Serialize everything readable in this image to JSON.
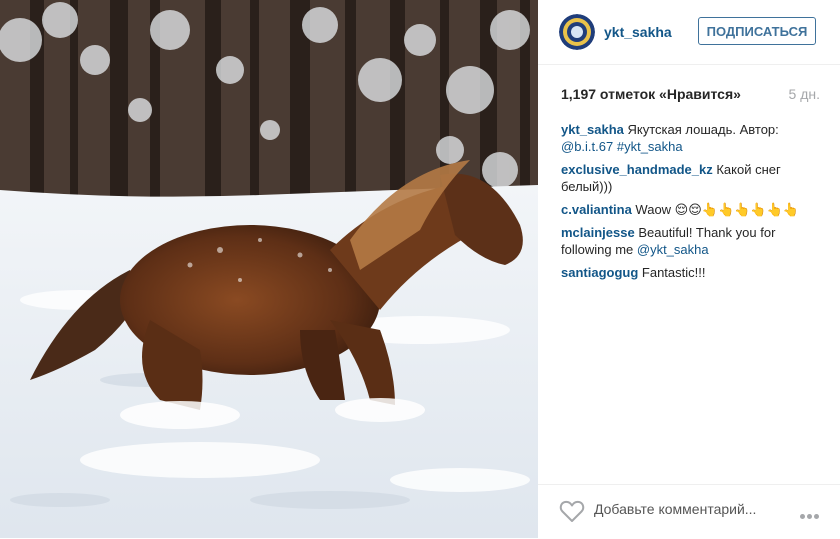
{
  "post": {
    "photo_alt": "",
    "author": "ykt_sakha",
    "follow_label": "ПОДПИСАТЬСЯ",
    "likes": "1,197 отметок «Нравится»",
    "timestamp": "5 дн.",
    "caption": {
      "user": "ykt_sakha",
      "text": " Якутская лошадь. Автор: ",
      "mention": "@b.i.t.67",
      "space": " ",
      "hashtag": "#ykt_sakha"
    }
  },
  "comments": [
    {
      "user": "exclusive_handmade_kz",
      "text": " Какой снег белый)))"
    },
    {
      "user": "c.valiantina",
      "text": " Waow 😌😌👆👆👆👆👆👆"
    },
    {
      "user": "mclainjesse",
      "text": " Beautiful! Thank you for following me ",
      "mention": "@ykt_sakha"
    },
    {
      "user": "santiagogug",
      "text": " Fantastic!!!"
    }
  ],
  "footer": {
    "comment_placeholder": "Добавьте комментарий...",
    "like_icon": "heart-outline-icon",
    "more_icon": "more-options-icon"
  },
  "colors": {
    "link": "#125688",
    "follow_border": "#3f729b",
    "muted": "#a5a7aa"
  }
}
